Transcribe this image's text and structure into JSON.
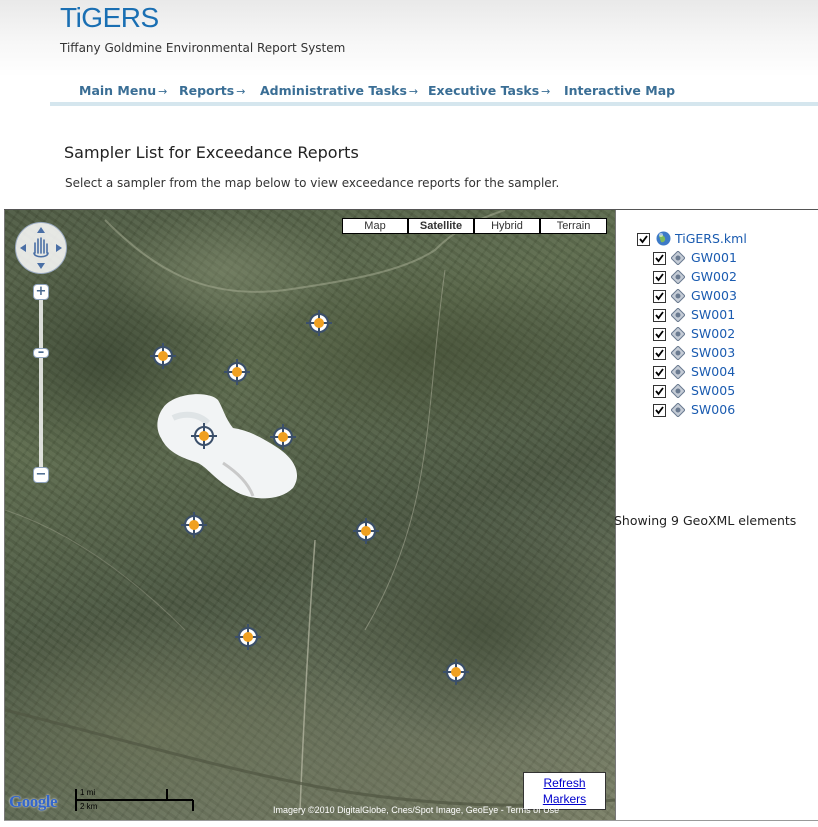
{
  "header": {
    "logo": "TiGERS",
    "subtitle": "Tiffany Goldmine Environmental Report System"
  },
  "nav": {
    "items": [
      {
        "label": "Main Menu",
        "arrow": "→"
      },
      {
        "label": "Reports",
        "arrow": "→"
      },
      {
        "label": "Administrative Tasks",
        "arrow": "→"
      },
      {
        "label": "Executive Tasks",
        "arrow": "→"
      },
      {
        "label": "Interactive Map",
        "arrow": ""
      }
    ]
  },
  "page": {
    "title": "Sampler List for Exceedance Reports",
    "description": "Select a sampler from the map below to view exceedance reports for the sampler."
  },
  "map": {
    "type_controls": [
      "Map",
      "Satellite",
      "Hybrid",
      "Terrain"
    ],
    "active_type": "Satellite",
    "zoom_in": "+",
    "zoom_out": "−",
    "refresh_line1": "Refresh",
    "refresh_line2": "Markers",
    "google_logo": "Google",
    "scale_mi": "1 mi",
    "scale_km": "2 km",
    "attribution": "Imagery ©2010 DigitalGlobe, Cnes/Spot Image, GeoEye - Terms of Use"
  },
  "sidebar": {
    "root": "TiGERS.kml",
    "items": [
      "GW001",
      "GW002",
      "GW003",
      "SW001",
      "SW002",
      "SW003",
      "SW004",
      "SW005",
      "SW006"
    ],
    "status": "Showing 9 GeoXML elements"
  },
  "colors": {
    "logo": "#1a6fb3",
    "nav_text": "#3a6e95",
    "nav_rule": "#d5e6ee",
    "link": "#1a5bb0",
    "marker_center": "#f0a020"
  },
  "icons": {
    "pan": "pan-hand-icon",
    "marker": "target-marker-icon",
    "kml": "globe-icon",
    "item": "diamond-target-icon"
  }
}
